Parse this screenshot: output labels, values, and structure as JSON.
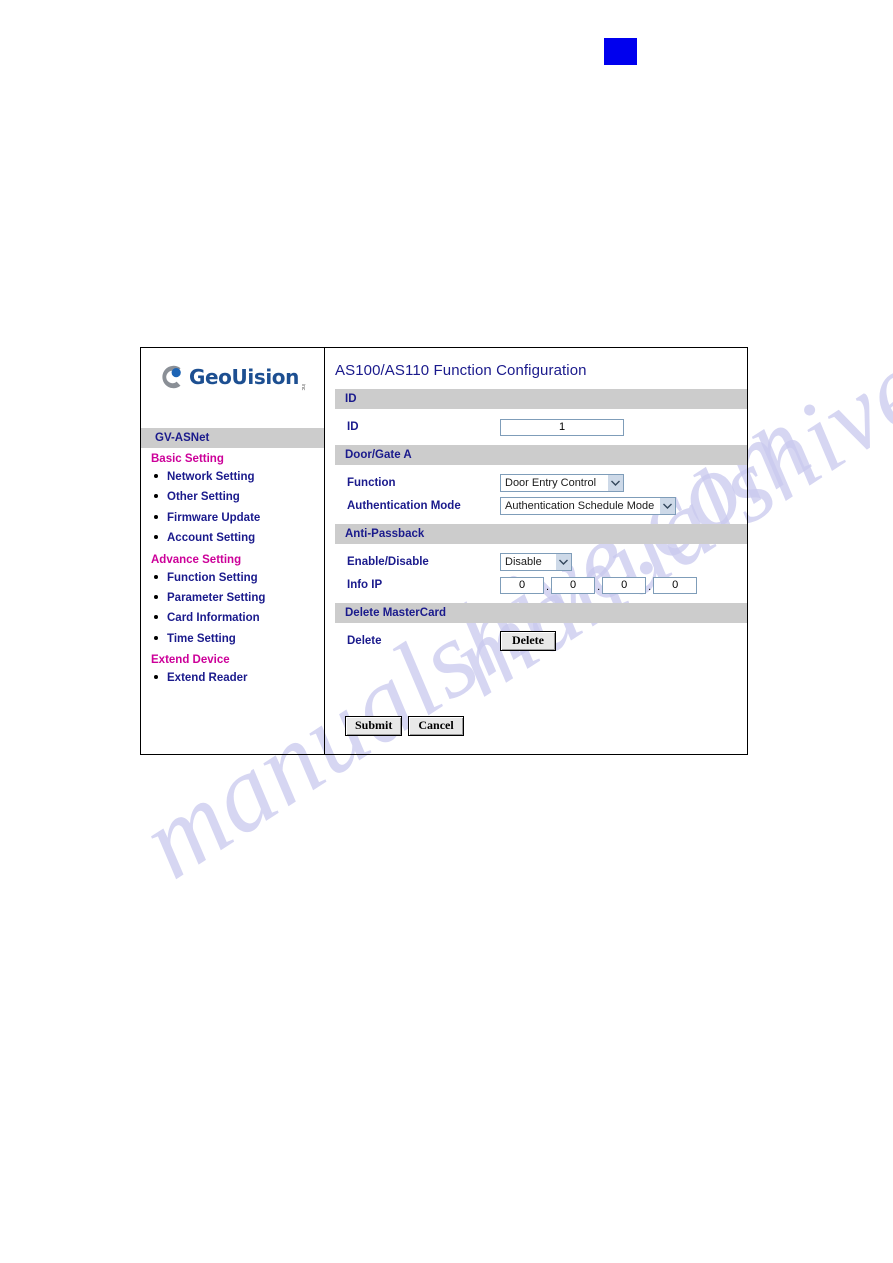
{
  "watermark": {
    "line1": "manualshive.com",
    "line2": "manualshive.com"
  },
  "marker": {
    "color": "#0000ee",
    "name": "blue-square-marker"
  },
  "sidebar": {
    "logo": {
      "word": "GeoUision",
      "suffix": "inc",
      "arc_color": "#8a8f96",
      "dot_color": "#1d64b5",
      "word_color": "#1d4f91"
    },
    "device_label": "GV-ASNet",
    "groups": [
      {
        "title": "Basic Setting",
        "items": [
          {
            "label": "Network Setting"
          },
          {
            "label": "Other Setting"
          },
          {
            "label": "Firmware Update"
          },
          {
            "label": "Account Setting"
          }
        ]
      },
      {
        "title": "Advance Setting",
        "items": [
          {
            "label": "Function Setting"
          },
          {
            "label": "Parameter Setting"
          },
          {
            "label": "Card Information"
          },
          {
            "label": "Time Setting"
          }
        ]
      },
      {
        "title": "Extend Device",
        "items": [
          {
            "label": "Extend Reader"
          }
        ]
      }
    ]
  },
  "content": {
    "page_title": "AS100/AS110 Function Configuration",
    "sections": {
      "id": {
        "bar_label": "ID",
        "id_label": "ID",
        "id_value": "1"
      },
      "door_gate": {
        "bar_label": "Door/Gate A",
        "function_label": "Function",
        "function_value": "Door Entry Control",
        "auth_label": "Authentication Mode",
        "auth_value": "Authentication Schedule Mode"
      },
      "anti_passback": {
        "bar_label": "Anti-Passback",
        "enable_label": "Enable/Disable",
        "enable_value": "Disable",
        "info_ip_label": "Info IP",
        "info_ip_octets": [
          "0",
          "0",
          "0",
          "0"
        ],
        "separator": "."
      },
      "delete_mastercard": {
        "bar_label": "Delete MasterCard",
        "delete_label": "Delete",
        "delete_button": "Delete"
      }
    },
    "footer": {
      "submit_label": "Submit",
      "cancel_label": "Cancel"
    }
  },
  "theme": {
    "section_bar_bg": "#cccccc",
    "label_blue": "#1a1a8c",
    "group_magenta": "#cc0099",
    "input_border": "#7f9db9"
  }
}
